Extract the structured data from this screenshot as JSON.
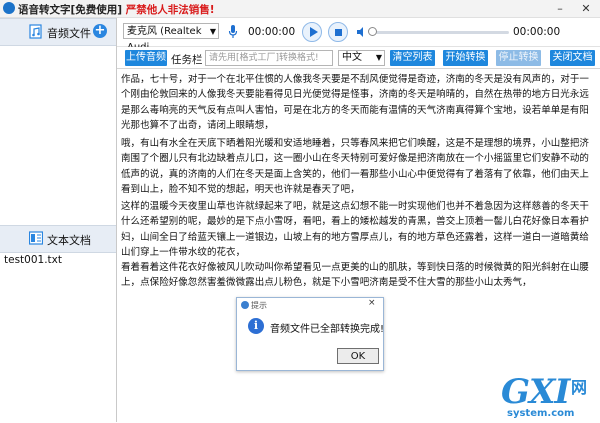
{
  "app": {
    "title": "语音转文字[免费使用]",
    "warning": "严禁他人非法销售!",
    "minimize": "–",
    "close": "✕"
  },
  "sidebar": {
    "audio_section": {
      "label": "音频文件",
      "add_label": "+"
    },
    "docs_section": {
      "label": "文本文档"
    },
    "files": [
      "test001.txt"
    ]
  },
  "player": {
    "device": "麦克风 (Realtek Audi",
    "time_elapsed": "00:00:00",
    "time_total": "00:00:00",
    "volume_level": 0.0
  },
  "toolbar": {
    "upload": "上传音频",
    "task_label": "任务栏",
    "task_placeholder": "请先用[格式工厂]转换格式!",
    "language": "中文",
    "clear": "清空列表",
    "start": "开始转换",
    "stop": "停止转换",
    "close_doc": "关闭文档"
  },
  "text_content": {
    "paragraphs": [
      "作品，七十号，对于一个在北平住惯的人像我冬天要是不刮风便觉得是奇迹，济南的冬天是没有风声的，对于一个刚由伦敦回来的人像我冬天要能看得见日光便觉得是怪事，济南的冬天是响晴的，自然在热带的地方日光永远是那么毒响亮的天气反有点叫人害怕，可是在北方的冬天而能有温情的天气济南真得算个宝地，设若单单是有阳光那也算不了出奇，请闭上眼睛想，",
      "哦，有山有水全在天底下晒着阳光暖和安适地睡着，只等春风来把它们唤醒，这是不是理想的境界，小山整把济南围了个圈儿只有北边缺着点儿口，这一圈小山在冬天特别可爱好像是把济南放在一个小摇篮里它们安静不动的低声的说，真的济南的人们在冬天是面上含笑的，他们一看那些小山心中便觉得有了着落有了依靠，他们由天上看到山上，脸不知不觉的想起，明天也许就是春天了吧，",
      "这样的温暖今天夜里山草也许就绿起来了吧，就是这点幻想不能一时实现他们也并不着急因为这样慈善的冬天干什么还希望别的呢，最妙的是下点小雪呀，看吧，看上的矮松越发的青黑，兽交上顶着一髻儿白花好像日本看护妇，山间全日了给蓝天镶上一道银边，山坡上有的地方雪厚点儿，有的地方草色还露着，这样一道白一道暗黄给山们穿上一件带水纹的花衣，",
      "看着看着这件花衣好像被风儿吹动叫你希望看见一点更美的山的肌肤，等到快日落的时候微黄的阳光斜射在山腰上，点保险好像忽然害羞微微露出点儿粉色，就是下小雪吧济南是受不住大雪的那些小山太秀气，"
    ]
  },
  "dialog": {
    "title": "提示",
    "message": "音频文件已全部转换完成!",
    "ok": "OK",
    "close": "×"
  },
  "watermark": {
    "logo": "GXI",
    "cn": "网",
    "domain": "system.com"
  },
  "colors": {
    "accent": "#1e87dd",
    "warning": "#d91a1a",
    "watermark": "#2a8ad6"
  }
}
